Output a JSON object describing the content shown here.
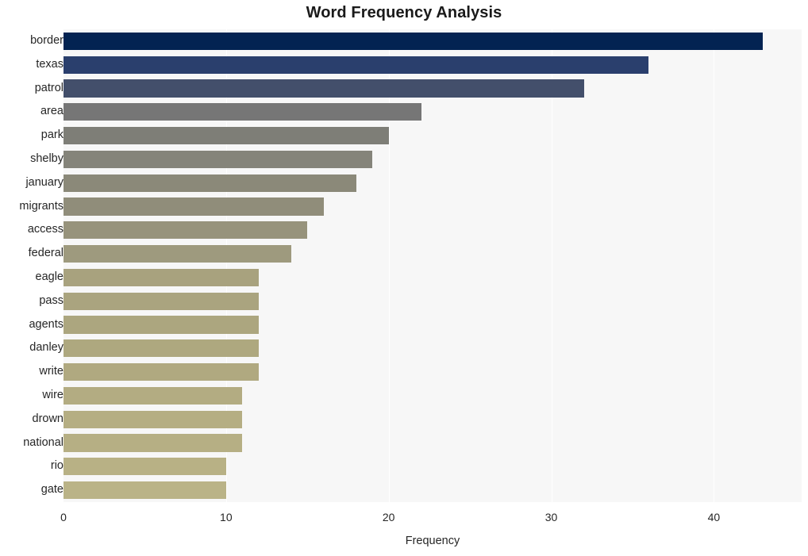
{
  "chart_data": {
    "type": "bar",
    "orientation": "horizontal",
    "title": "Word Frequency Analysis",
    "xlabel": "Frequency",
    "ylabel": "",
    "categories": [
      "border",
      "texas",
      "patrol",
      "area",
      "park",
      "shelby",
      "january",
      "migrants",
      "access",
      "federal",
      "eagle",
      "pass",
      "agents",
      "danley",
      "write",
      "wire",
      "drown",
      "national",
      "rio",
      "gate"
    ],
    "values": [
      43,
      36,
      32,
      22,
      20,
      19,
      18,
      16,
      15,
      14,
      12,
      12,
      12,
      12,
      12,
      11,
      11,
      11,
      10,
      10
    ],
    "bar_colors": [
      "#032352",
      "#2a3f6d",
      "#434f6b",
      "#767676",
      "#7e7e77",
      "#85847a",
      "#8b8979",
      "#908d7a",
      "#97937c",
      "#9e9a7e",
      "#a8a27e",
      "#aaa47f",
      "#aca67f",
      "#aea87f",
      "#b0a980",
      "#b3ac82",
      "#b5ae83",
      "#b6af84",
      "#b8b185",
      "#bab387"
    ],
    "xlim": [
      0,
      45.4
    ],
    "xticks": [
      0,
      10,
      20,
      30,
      40
    ],
    "xtick_labels": [
      "0",
      "10",
      "20",
      "30",
      "40"
    ],
    "grid": "vertical",
    "gridlines_at": [
      10,
      20,
      30,
      40
    ],
    "legend": "none",
    "plot_background": "#f7f7f7",
    "figure_background": "#ffffff",
    "gridline_color": "#ffffff",
    "text_color": "#262626"
  }
}
